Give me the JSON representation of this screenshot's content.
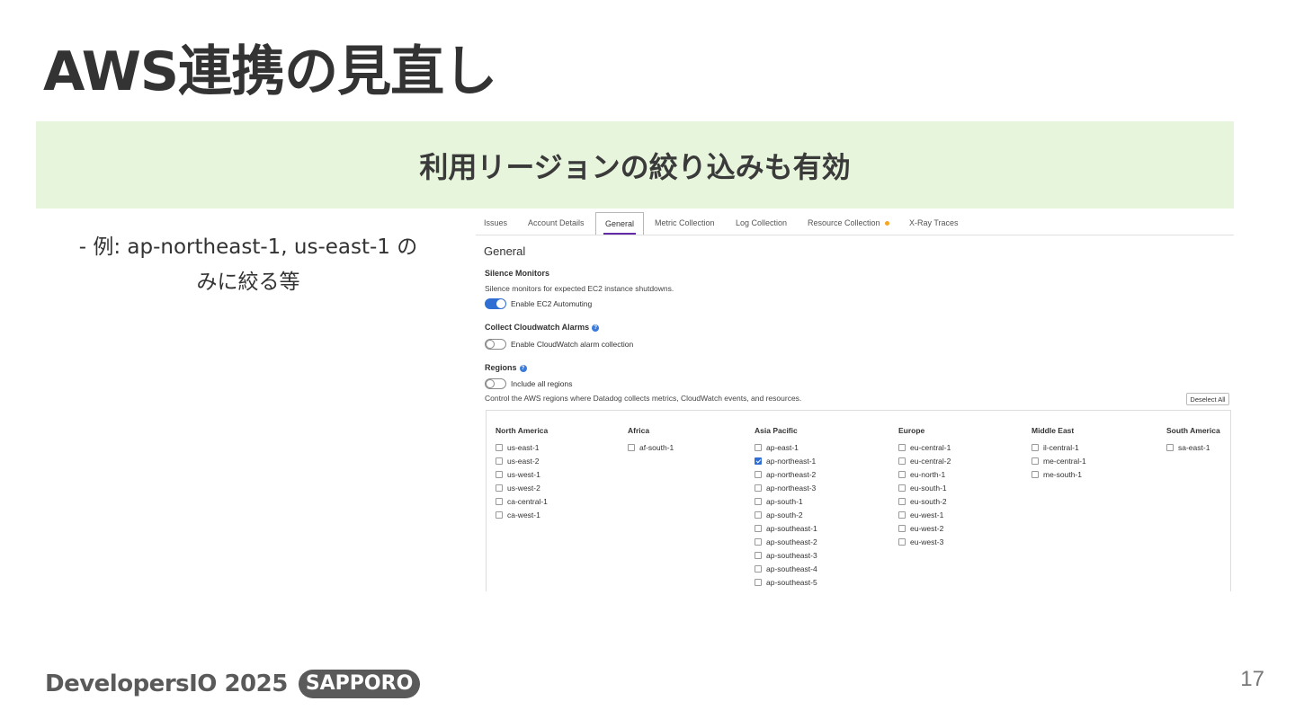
{
  "slide": {
    "title": "AWS連携の見直し",
    "banner": "利用リージョンの絞り込みも有効",
    "bullet_line1": "- 例: ap-northeast-1, us-east-1 の",
    "bullet_line2": "みに絞る等",
    "page_number": "17",
    "logo": {
      "text": "DevelopersIO 2025",
      "badge": "SAPPORO"
    }
  },
  "ui": {
    "tabs": [
      {
        "label": "Issues"
      },
      {
        "label": "Account Details"
      },
      {
        "label": "General",
        "active": true
      },
      {
        "label": "Metric Collection"
      },
      {
        "label": "Log Collection"
      },
      {
        "label": "Resource Collection",
        "badge_dot": true
      },
      {
        "label": "X-Ray Traces"
      }
    ],
    "section_title": "General",
    "silence_monitors": {
      "heading": "Silence Monitors",
      "description": "Silence monitors for expected EC2 instance shutdowns.",
      "toggle_label": "Enable EC2 Automuting",
      "enabled": true
    },
    "cloudwatch_alarms": {
      "heading": "Collect Cloudwatch Alarms",
      "toggle_label": "Enable CloudWatch alarm collection",
      "enabled": false
    },
    "regions": {
      "heading": "Regions",
      "toggle_label": "Include all regions",
      "include_all": false,
      "description": "Control the AWS regions where Datadog collects metrics, CloudWatch events, and resources.",
      "deselect_all_label": "Deselect All",
      "groups": [
        {
          "name": "North America",
          "items": [
            "us-east-1",
            "us-east-2",
            "us-west-1",
            "us-west-2",
            "ca-central-1",
            "ca-west-1"
          ],
          "checked": []
        },
        {
          "name": "Africa",
          "items": [
            "af-south-1"
          ],
          "checked": []
        },
        {
          "name": "Asia Pacific",
          "items": [
            "ap-east-1",
            "ap-northeast-1",
            "ap-northeast-2",
            "ap-northeast-3",
            "ap-south-1",
            "ap-south-2",
            "ap-southeast-1",
            "ap-southeast-2",
            "ap-southeast-3",
            "ap-southeast-4",
            "ap-southeast-5"
          ],
          "checked": [
            "ap-northeast-1"
          ]
        },
        {
          "name": "Europe",
          "items": [
            "eu-central-1",
            "eu-central-2",
            "eu-north-1",
            "eu-south-1",
            "eu-south-2",
            "eu-west-1",
            "eu-west-2",
            "eu-west-3"
          ],
          "checked": []
        },
        {
          "name": "Middle East",
          "items": [
            "il-central-1",
            "me-central-1",
            "me-south-1"
          ],
          "checked": []
        },
        {
          "name": "South America",
          "items": [
            "sa-east-1"
          ],
          "checked": []
        }
      ]
    }
  },
  "colors": {
    "banner_bg": "#e8f5dd",
    "toggle_on": "#2f6ed3",
    "active_tab_underline": "#632ca6",
    "badge_dot": "#f5a623"
  }
}
